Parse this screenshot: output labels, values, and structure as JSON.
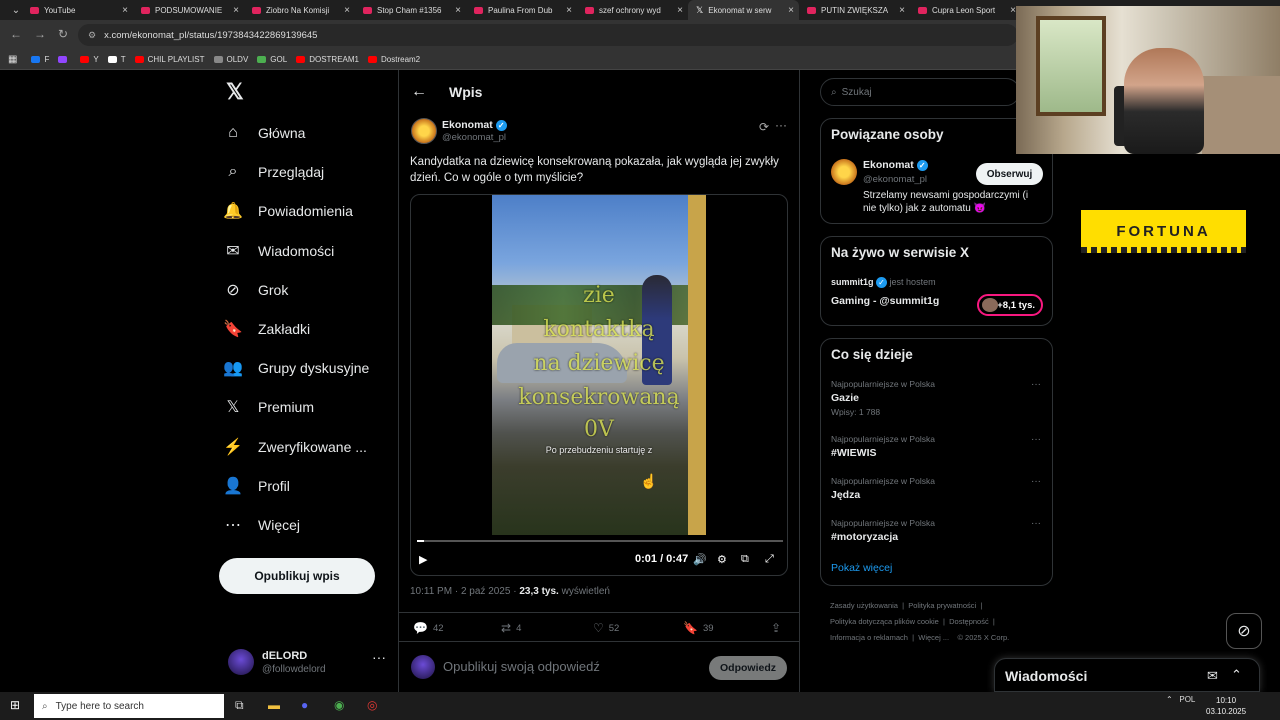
{
  "browser": {
    "tabs": [
      {
        "title": "YouTube",
        "icon": "youtube-icon"
      },
      {
        "title": "PODSUMOWANIE",
        "icon": "youtube-icon"
      },
      {
        "title": "Ziobro Na Komisji",
        "icon": "youtube-icon"
      },
      {
        "title": "Stop Cham #1356",
        "icon": "youtube-icon"
      },
      {
        "title": "Paulina From Dub",
        "icon": "youtube-icon"
      },
      {
        "title": "szef ochrony wyd",
        "icon": "youtube-icon"
      },
      {
        "title": "Ekonomat w serw",
        "icon": "x-icon",
        "active": true
      },
      {
        "title": "PUTIN ZWIĘKSZA",
        "icon": "youtube-icon"
      },
      {
        "title": "Cupra Leon Sport",
        "icon": "youtube-icon"
      }
    ],
    "url": "x.com/ekonomat_pl/status/1973843422869139645",
    "bookmarks": [
      {
        "label": "F",
        "color": "#1877f2"
      },
      {
        "label": "",
        "color": "#9146ff"
      },
      {
        "label": "Y",
        "color": "#ff0000"
      },
      {
        "label": "T",
        "color": "#ffffff"
      },
      {
        "label": "CHIL PLAYLIST",
        "color": "#ff0000"
      },
      {
        "label": "OLDV",
        "color": "#888888"
      },
      {
        "label": "GOL",
        "color": "#4caf50"
      },
      {
        "label": "DOSTREAM1",
        "color": "#ff0000"
      },
      {
        "label": "Dostream2",
        "color": "#ff0000"
      }
    ]
  },
  "nav": {
    "items": [
      {
        "label": "Główna",
        "icon": "home-icon"
      },
      {
        "label": "Przeglądaj",
        "icon": "search-icon"
      },
      {
        "label": "Powiadomienia",
        "icon": "bell-icon"
      },
      {
        "label": "Wiadomości",
        "icon": "mail-icon"
      },
      {
        "label": "Grok",
        "icon": "grok-icon"
      },
      {
        "label": "Zakładki",
        "icon": "bookmark-icon"
      },
      {
        "label": "Grupy dyskusyjne",
        "icon": "people-icon"
      },
      {
        "label": "Premium",
        "icon": "x-logo-icon"
      },
      {
        "label": "Zweryfikowane ...",
        "icon": "bolt-icon"
      },
      {
        "label": "Profil",
        "icon": "person-icon"
      },
      {
        "label": "Więcej",
        "icon": "more-circle-icon"
      }
    ],
    "post_button": "Opublikuj wpis",
    "account": {
      "name": "dELORD",
      "handle": "@followdelord"
    }
  },
  "post": {
    "header": "Wpis",
    "author_name": "Ekonomat",
    "author_handle": "@ekonomat_pl",
    "text": "Kandydatka na dziewicę konsekrowaną pokazała, jak wygląda jej zwykły dzień. Co w ogóle o tym myślicie?",
    "video": {
      "overlay_lines": [
        "zie",
        "kontaktką",
        "na dziewicę",
        "konsekrowaną",
        "0V"
      ],
      "caption": "Po przebudzeniu startuję z",
      "time": "0:01 / 0:47",
      "progress": 0.02
    },
    "timestamp": "10:11 PM · 2 paź 2025 · ",
    "views_count": "23,3 tys.",
    "views_label": " wyświetleń",
    "replies": "42",
    "reposts": "4",
    "likes": "52",
    "bookmarks": "39",
    "reply_placeholder": "Opublikuj swoją odpowiedź",
    "reply_button": "Odpowiedz"
  },
  "right": {
    "search_placeholder": "Szukaj",
    "related_title": "Powiązane osoby",
    "related": {
      "name": "Ekonomat",
      "handle": "@ekonomat_pl",
      "follow": "Obserwuj",
      "bio": "Strzelamy newsami gospodarczymi (i nie tylko) jak z automatu 😈"
    },
    "live_title": "Na żywo w serwisie X",
    "live": {
      "host": "summit1g",
      "host_suffix": "jest hostem",
      "space": "Gaming - @summit1g",
      "listeners": "+8,1 tys."
    },
    "trends_title": "Co się dzieje",
    "trends": [
      {
        "context": "Najpopularniejsze w Polska",
        "name": "Gazie",
        "count": "Wpisy: 1 788"
      },
      {
        "context": "Najpopularniejsze w Polska",
        "name": "#WIEWIS",
        "count": ""
      },
      {
        "context": "Najpopularniejsze w Polska",
        "name": "Jędza",
        "count": ""
      },
      {
        "context": "Najpopularniejsze w Polska",
        "name": "#motoryzacja",
        "count": ""
      }
    ],
    "show_more": "Pokaż więcej",
    "footer": [
      "Zasady użytkowania",
      "Polityka prywatności",
      "Polityka dotycząca plików cookie",
      "Dostępność",
      "Informacja o reklamach",
      "Więcej ...",
      "© 2025 X Corp."
    ]
  },
  "overlay": {
    "ad_text": "FORTUNA",
    "messages_title": "Wiadomości"
  },
  "taskbar": {
    "search_placeholder": "Type here to search",
    "lang": "POL",
    "time": "10:10",
    "date": "03.10.2025"
  }
}
